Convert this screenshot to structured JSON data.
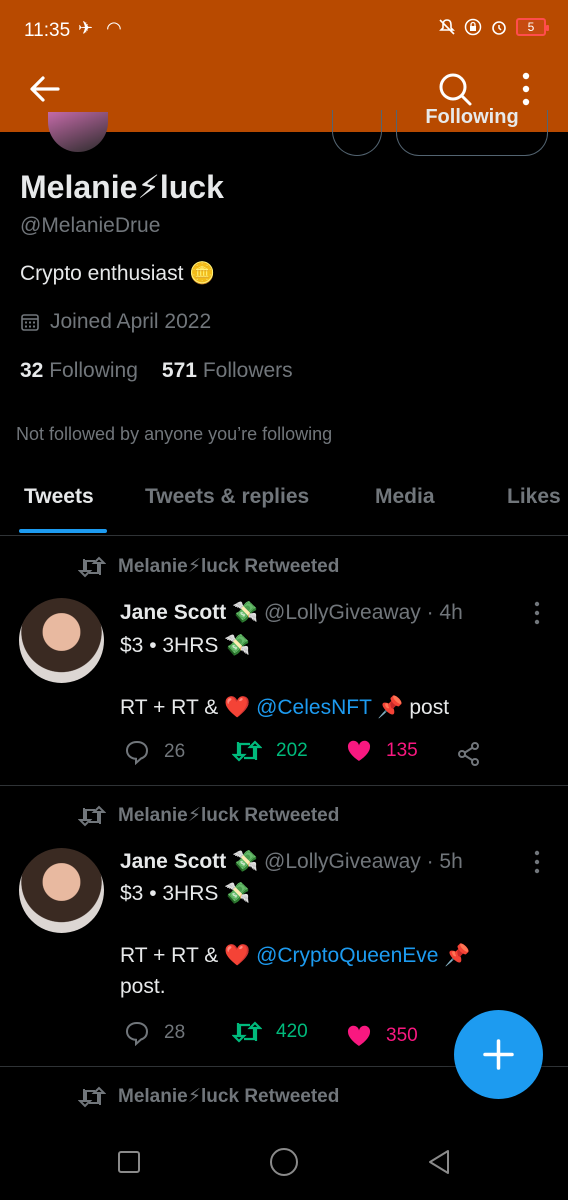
{
  "status_bar": {
    "time": "11:35",
    "battery": "5"
  },
  "profile": {
    "name": "Melanie⚡luck",
    "handle": "@MelanieDrue",
    "bio": "Crypto enthusiast 🪙",
    "joined": "Joined April 2022",
    "following_count": "32",
    "following_label": "Following",
    "followers_count": "571",
    "followers_label": "Followers",
    "not_followed": "Not followed by anyone you’re following",
    "following_button": "Following"
  },
  "tabs": [
    {
      "label": "Tweets",
      "active": true
    },
    {
      "label": "Tweets & replies",
      "active": false
    },
    {
      "label": "Media",
      "active": false
    },
    {
      "label": "Likes",
      "active": false
    }
  ],
  "tweets": [
    {
      "retweet_label": "Melanie⚡luck Retweeted",
      "author": "Jane Scott 💸",
      "handle": "@LollyGiveaway",
      "time": "· 4h",
      "line1": "$3 • 3HRS 💸",
      "line2_prefix": "RT + RT & ❤️ ",
      "mention": "@CelesNFT",
      "line2_suffix": " 📌 post",
      "replies": "26",
      "retweets": "202",
      "likes": "135"
    },
    {
      "retweet_label": "Melanie⚡luck Retweeted",
      "author": "Jane Scott 💸",
      "handle": "@LollyGiveaway",
      "time": "· 5h",
      "line1": "$3 • 3HRS 💸",
      "line2_prefix": "RT + RT & ❤️ ",
      "mention": "@CryptoQueenEve",
      "line2_suffix": " 📌 post.",
      "replies": "28",
      "retweets": "420",
      "likes": "350"
    },
    {
      "retweet_label": "Melanie⚡luck Retweeted"
    }
  ],
  "colors": {
    "app_bar": "#b84a00",
    "accent": "#1d9bf0",
    "retweet": "#00ba7c",
    "like": "#f91880"
  }
}
